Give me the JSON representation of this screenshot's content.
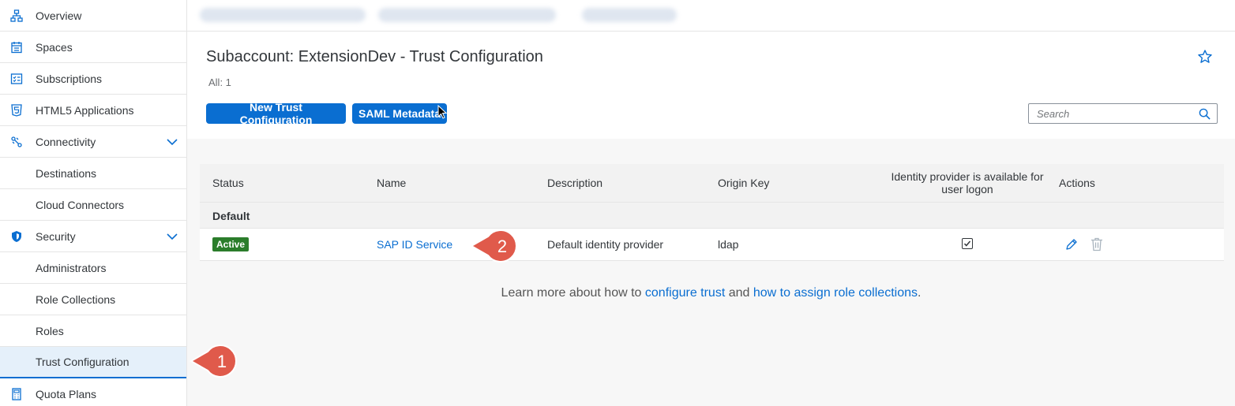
{
  "sidebar": {
    "items": [
      {
        "label": "Overview",
        "icon": "sitemap-icon"
      },
      {
        "label": "Spaces",
        "icon": "calendar-icon"
      },
      {
        "label": "Subscriptions",
        "icon": "checklist-icon"
      },
      {
        "label": "HTML5 Applications",
        "icon": "html5-icon"
      },
      {
        "label": "Connectivity",
        "icon": "connectivity-icon",
        "expanded": true
      },
      {
        "label": "Destinations"
      },
      {
        "label": "Cloud Connectors"
      },
      {
        "label": "Security",
        "icon": "shield-icon",
        "expanded": true
      },
      {
        "label": "Administrators"
      },
      {
        "label": "Role Collections"
      },
      {
        "label": "Roles"
      },
      {
        "label": "Trust Configuration",
        "active": true
      },
      {
        "label": "Quota Plans",
        "icon": "calculator-icon"
      }
    ]
  },
  "header": {
    "title": "Subaccount: ExtensionDev - Trust Configuration",
    "count": "All: 1",
    "new_button": "New Trust Configuration",
    "saml_button": "SAML Metadata",
    "search_placeholder": "Search"
  },
  "table": {
    "columns": [
      "Status",
      "Name",
      "Description",
      "Origin Key",
      "Identity provider is available for user logon",
      "Actions"
    ],
    "groups": [
      {
        "label": "Default",
        "rows": [
          {
            "status": "Active",
            "name": "SAP ID Service",
            "description": "Default identity provider",
            "origin_key": "ldap",
            "available": true
          }
        ]
      }
    ]
  },
  "footer": {
    "prefix": "Learn more about how to ",
    "link1": "configure trust",
    "middle": " and ",
    "link2": "how to assign role collections",
    "suffix": "."
  },
  "callouts": [
    "1",
    "2"
  ],
  "colors": {
    "accent": "#0a6ed1",
    "active_badge": "#2b7d2b",
    "callout": "#e05a4b"
  }
}
